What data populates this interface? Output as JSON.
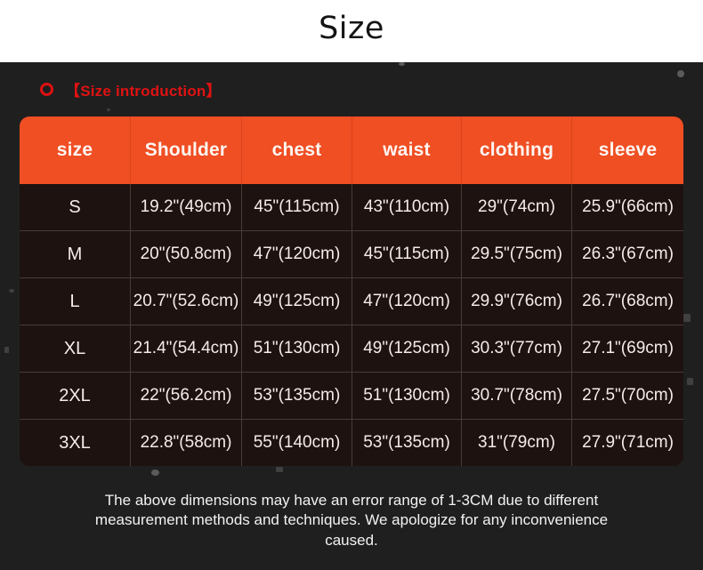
{
  "title": "Size",
  "section": {
    "icon": "ring-icon",
    "label": "【Size introduction】"
  },
  "colors": {
    "header_orange": "#f04e23",
    "table_background": "#1d1210",
    "page_background": "#1f1f1f",
    "accent_red": "#e01212",
    "text_light": "#f5ece8"
  },
  "table": {
    "columns": [
      "size",
      "Shoulder",
      "chest",
      "waist",
      "clothing",
      "sleeve"
    ],
    "rows": [
      {
        "size": "S",
        "shoulder": "19.2\"(49cm)",
        "chest": "45\"(115cm)",
        "waist": "43\"(110cm)",
        "clothing": "29\"(74cm)",
        "sleeve": "25.9\"(66cm)"
      },
      {
        "size": "M",
        "shoulder": "20\"(50.8cm)",
        "chest": "47\"(120cm)",
        "waist": "45\"(115cm)",
        "clothing": "29.5\"(75cm)",
        "sleeve": "26.3\"(67cm)"
      },
      {
        "size": "L",
        "shoulder": "20.7\"(52.6cm)",
        "chest": "49\"(125cm)",
        "waist": "47\"(120cm)",
        "clothing": "29.9\"(76cm)",
        "sleeve": "26.7\"(68cm)"
      },
      {
        "size": "XL",
        "shoulder": "21.4\"(54.4cm)",
        "chest": "51\"(130cm)",
        "waist": "49\"(125cm)",
        "clothing": "30.3\"(77cm)",
        "sleeve": "27.1\"(69cm)"
      },
      {
        "size": "2XL",
        "shoulder": "22\"(56.2cm)",
        "chest": "53\"(135cm)",
        "waist": "51\"(130cm)",
        "clothing": "30.7\"(78cm)",
        "sleeve": "27.5\"(70cm)"
      },
      {
        "size": "3XL",
        "shoulder": "22.8\"(58cm)",
        "chest": "55\"(140cm)",
        "waist": "53\"(135cm)",
        "clothing": "31\"(79cm)",
        "sleeve": "27.9\"(71cm)"
      }
    ]
  },
  "footer": {
    "note": "The above dimensions may have an error range of 1-3CM due to different measurement methods and techniques. We apologize for any inconvenience caused."
  }
}
